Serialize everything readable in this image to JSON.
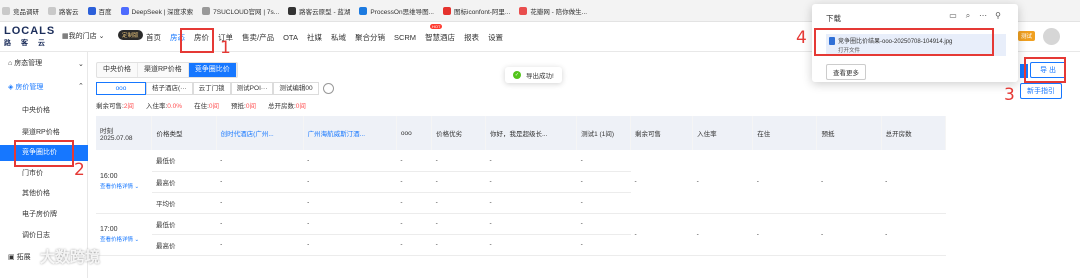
{
  "bookmarks": [
    "竞品调研",
    "路客云",
    "百度",
    "DeepSeek | 深度求索",
    "7SUCLOUD官网 | 7s...",
    "路客云原型 - 蓝湖",
    "ProcessOn思维导图...",
    "图标iconfont-阿里...",
    "花瓣网 - 陪你做生..."
  ],
  "logo": {
    "line1": "LOCALS",
    "line2": "路 客 云"
  },
  "store_label": "我的门店",
  "custom_badge": "定制版",
  "nav": [
    "首页",
    "房态",
    "房价",
    "订单",
    "售卖/产品",
    "OTA",
    "社媒",
    "私域",
    "聚合分销",
    "SCRM",
    "智慧酒店",
    "报表",
    "设置"
  ],
  "hot_label": "HOT",
  "test_badge": "测试",
  "sidebar": {
    "items": [
      {
        "label": "房态管理",
        "type": "group"
      },
      {
        "label": "房价管理",
        "type": "group-open"
      },
      {
        "label": "中央价格"
      },
      {
        "label": "渠道RP价格"
      },
      {
        "label": "竞争圈比价",
        "active": true
      },
      {
        "label": "门市价"
      },
      {
        "label": "其他价格"
      },
      {
        "label": "电子房价牌"
      },
      {
        "label": "调价日志"
      },
      {
        "label": "拓展"
      }
    ]
  },
  "tabs": [
    "中央价格",
    "渠道RP价格",
    "竞争圈比价"
  ],
  "filters": [
    "ooo",
    "桔子酒店(···",
    "云丁门锁",
    "测试POI···",
    "测试编辑00"
  ],
  "stats": [
    {
      "label": "剩余可售:",
      "value": "2间"
    },
    {
      "label": "入住率:",
      "value": "0.0%"
    },
    {
      "label": "在住:",
      "value": "0间"
    },
    {
      "label": "预抵:",
      "value": "0间"
    },
    {
      "label": "总开房数:",
      "value": "0间"
    }
  ],
  "table": {
    "time_header": "时刻",
    "date": "2025.07.08",
    "columns": [
      "价格类型",
      "创时代酒店(广州...",
      "广州海航威斯汀酒...",
      "ooo",
      "价格优劣",
      "你好，我是超级长...",
      "测试1 (1间)",
      "剩余可售",
      "入住率",
      "在住",
      "预抵",
      "总开房数"
    ],
    "rows": [
      {
        "type": "最低价"
      },
      {
        "type": "最高价"
      },
      {
        "type": "平均价"
      },
      {
        "type": "最低价"
      },
      {
        "type": "最高价"
      }
    ],
    "time1": "16:00",
    "time2": "17:00",
    "detail_link": "查看价格详情",
    "dash": "-"
  },
  "toast": "导出成功!",
  "buttons": {
    "export": "导 出",
    "guide": "新手指引"
  },
  "download": {
    "title": "下载",
    "file_name": "竞争圈比价结果-ooo-20250708-104914.jpg",
    "open_label": "打开文件",
    "more_label": "查看更多"
  },
  "annotations": [
    "1",
    "2",
    "3",
    "4"
  ],
  "watermark": "大数跨境"
}
